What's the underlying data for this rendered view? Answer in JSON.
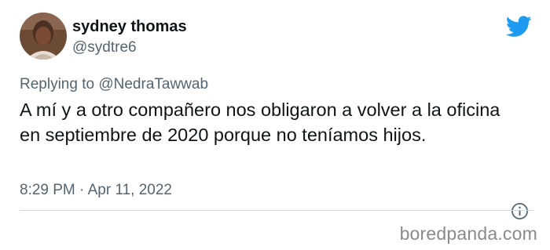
{
  "tweet": {
    "author": {
      "display_name": "sydney thomas",
      "handle": "@sydtre6",
      "avatar": "profile-photo"
    },
    "reply_to": {
      "prefix": "Replying to",
      "mention": "@NedraTawwab"
    },
    "text": "A mí y a otro compañero nos obligaron a volver a la oficina en septiembre de 2020 porque no teníamos hijos.",
    "timestamp": "8:29 PM · Apr 11, 2022",
    "icons": {
      "platform": "twitter-bird-icon",
      "info": "info-icon"
    },
    "colors": {
      "brand_blue": "#1d9bf0",
      "secondary_text": "#536471",
      "primary_text": "#0f1419",
      "divider": "#cfd9de"
    }
  },
  "watermark": {
    "text": "boredpanda.com",
    "color": "#8a8a8a"
  }
}
